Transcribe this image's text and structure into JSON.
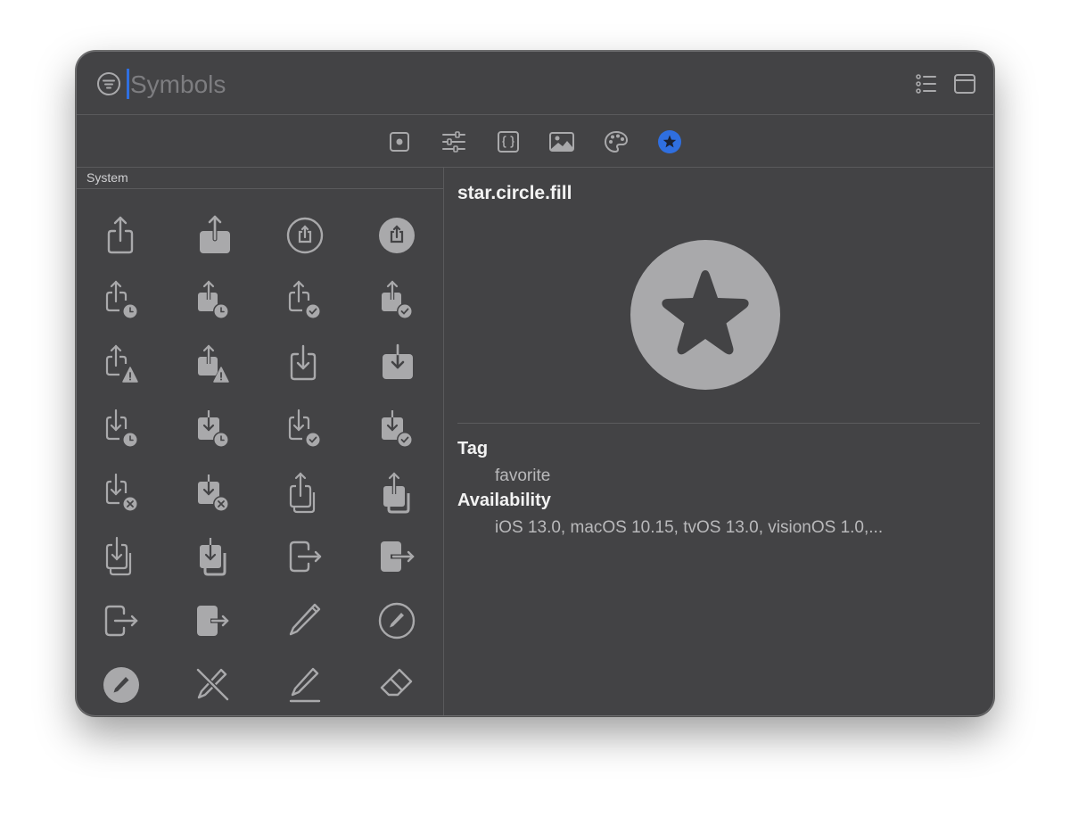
{
  "search": {
    "placeholder": "Symbols",
    "value": ""
  },
  "titlebar": {
    "filter_icon": "line-3-horizontal-decrease-circle-icon",
    "right_buttons": [
      {
        "icon": "list-bullet-icon"
      },
      {
        "icon": "window-icon"
      }
    ]
  },
  "toolbar": {
    "buttons": [
      {
        "icon": "square-dot-icon",
        "selected": false
      },
      {
        "icon": "slider-horizontal-3-icon",
        "selected": false
      },
      {
        "icon": "curly-braces-square-icon",
        "selected": false
      },
      {
        "icon": "photo-icon",
        "selected": false
      },
      {
        "icon": "paintpalette-icon",
        "selected": false
      },
      {
        "icon": "star-circle-fill-icon",
        "selected": true
      }
    ]
  },
  "sidebar": {
    "section_title": "System",
    "symbols": [
      "square-and-arrow-up-icon",
      "square-and-arrow-up-fill-icon",
      "square-and-arrow-up-circle-icon",
      "square-and-arrow-up-circle-fill-icon",
      "square-and-arrow-up-badge-clock-icon",
      "square-and-arrow-up-badge-clock-fill-icon",
      "square-and-arrow-up-badge-checkmark-icon",
      "square-and-arrow-up-badge-checkmark-fill-icon",
      "square-and-arrow-up-trianglebadge-exclamationmark-icon",
      "square-and-arrow-up-fill-trianglebadge-exclamationmark-icon",
      "square-and-arrow-down-icon",
      "square-and-arrow-down-fill-icon",
      "square-and-arrow-down-badge-clock-icon",
      "square-and-arrow-down-badge-clock-fill-icon",
      "square-and-arrow-down-badge-checkmark-icon",
      "square-and-arrow-down-badge-checkmark-fill-icon",
      "square-and-arrow-down-badge-xmark-icon",
      "square-and-arrow-down-badge-xmark-fill-icon",
      "square-and-arrow-up-on-square-icon",
      "square-and-arrow-up-on-square-fill-icon",
      "square-and-arrow-down-on-square-icon",
      "square-and-arrow-down-on-square-fill-icon",
      "rectangle-portrait-and-arrow-right-icon",
      "rectangle-portrait-and-arrow-right-fill-icon",
      "rectangle-portrait-and-arrow-forward-icon",
      "rectangle-portrait-and-arrow-forward-fill-icon",
      "pencil-icon",
      "pencil-circle-icon",
      "pencil-circle-fill-icon",
      "pencil-slash-icon",
      "pencil-line-icon",
      "eraser-icon"
    ]
  },
  "detail": {
    "symbol_name": "star.circle.fill",
    "preview_icon": "star-circle-fill-icon",
    "tag_label": "Tag",
    "tag_value": "favorite",
    "availability_label": "Availability",
    "availability_value": "iOS 13.0, macOS 10.15, tvOS 13.0, visionOS 1.0,..."
  },
  "colors": {
    "window_bg": "#434345",
    "icon_gray": "#a9a9ab",
    "accent_blue": "#2f6fe0",
    "text_primary": "#f2f2f2",
    "text_secondary": "#b9b9bb"
  }
}
